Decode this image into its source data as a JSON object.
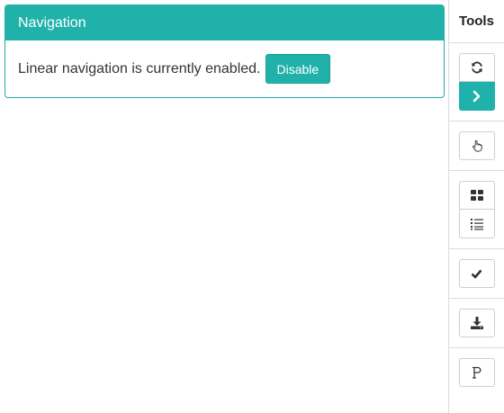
{
  "navigation_panel": {
    "title": "Navigation",
    "message": "Linear navigation is currently enabled.",
    "disable_label": "Disable"
  },
  "tools": {
    "title": "Tools",
    "buttons": [
      {
        "icon": "refresh-icon"
      },
      {
        "icon": "chevron-right-icon",
        "active": true
      },
      {
        "icon": "pointer-hand-icon"
      },
      {
        "icon": "grid-view-icon"
      },
      {
        "icon": "list-view-icon"
      },
      {
        "icon": "checkmark-icon"
      },
      {
        "icon": "download-icon"
      },
      {
        "icon": "format-icon"
      }
    ]
  },
  "colors": {
    "accent": "#20b2aa",
    "border": "#dcdcdc",
    "text": "#333333"
  }
}
